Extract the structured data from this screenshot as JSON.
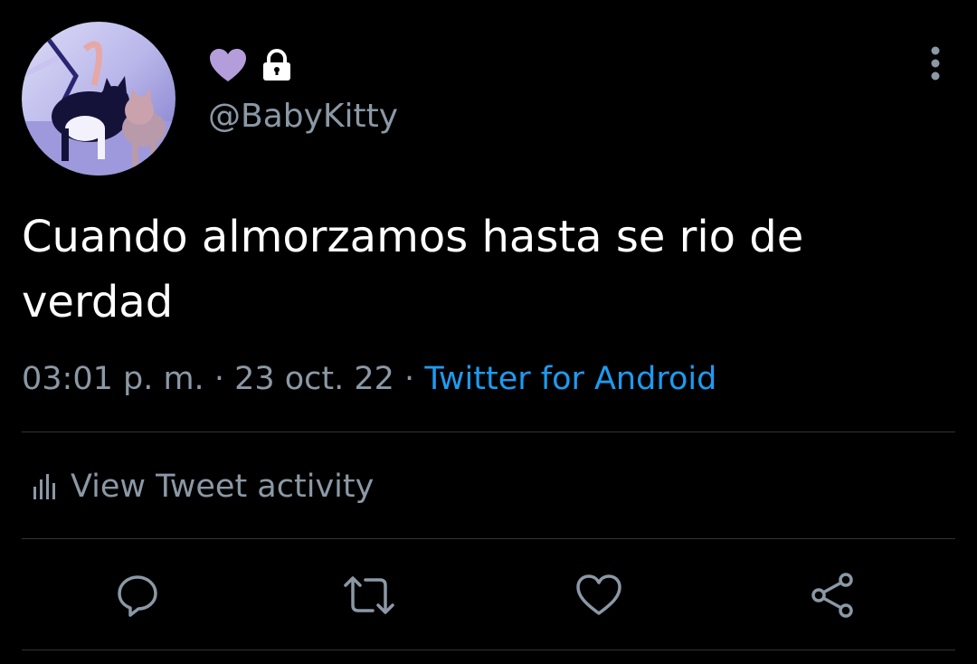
{
  "profile": {
    "avatar_icon": "cats-avatar",
    "badge_icon": "purple-heart-icon",
    "lock_icon": "lock-icon",
    "handle": "@BabyKitty"
  },
  "tweet": {
    "text": "Cuando almorzamos hasta se rio de\nverdad",
    "time": "03:01 p. m.",
    "separator": " · ",
    "date": "23 oct. 22",
    "source": "Twitter for Android"
  },
  "activity": {
    "label": "View Tweet activity",
    "icon": "bar-chart-icon"
  },
  "actions": {
    "reply_icon": "reply-icon",
    "retweet_icon": "retweet-icon",
    "like_icon": "heart-icon",
    "share_icon": "share-icon",
    "more_icon": "more-vertical-icon"
  },
  "colors": {
    "background": "#000000",
    "text_primary": "#ffffff",
    "text_secondary": "#8b98a5",
    "accent": "#1d9bf0",
    "heart_badge": "#b39ddb",
    "divider": "#2f3336"
  }
}
